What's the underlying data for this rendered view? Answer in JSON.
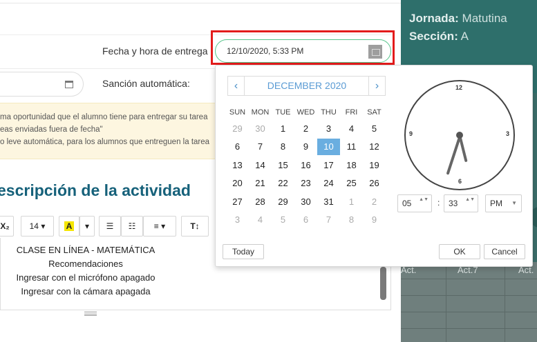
{
  "info": {
    "jornada_label": "Jornada:",
    "jornada_value": "Matutina",
    "seccion_label": "Sección:",
    "seccion_value": "A",
    "grid_headers": [
      "Act.",
      "Act.7",
      "Act."
    ]
  },
  "form": {
    "due_label": "Fecha y hora de entrega",
    "due_value": "12/10/2020, 5:33 PM",
    "sancion_label": "Sanción automática:",
    "notes": [
      "ma oportunidad que el alumno tiene para entregar su tarea",
      "eas enviadas fuera de fecha\"",
      "o leve automática, para los alumnos que entreguen la tarea"
    ],
    "heading": "escripción de la actividad"
  },
  "toolbar": {
    "font_size": "14",
    "font_size_caret": "▾",
    "subscript": "X₂",
    "text_color": "A",
    "caret": "▾",
    "bullet_list": "☰",
    "numbered_list": "☷",
    "align": "≡",
    "text_style": "T↕"
  },
  "editor": {
    "lines": [
      "CLASE EN LÍNEA - MATEMÁTICA",
      "Recomendaciones",
      "Ingresar con el micrófono apagado",
      "Ingresar con la cámara apagada"
    ]
  },
  "picker": {
    "prev": "‹",
    "next": "›",
    "month": "DECEMBER 2020",
    "weekdays": [
      "SUN",
      "MON",
      "TUE",
      "WED",
      "THU",
      "FRI",
      "SAT"
    ],
    "weeks": [
      [
        "29",
        "30",
        "1",
        "2",
        "3",
        "4",
        "5"
      ],
      [
        "6",
        "7",
        "8",
        "9",
        "10",
        "11",
        "12"
      ],
      [
        "13",
        "14",
        "15",
        "16",
        "17",
        "18",
        "19"
      ],
      [
        "20",
        "21",
        "22",
        "23",
        "24",
        "25",
        "26"
      ],
      [
        "27",
        "28",
        "29",
        "30",
        "31",
        "1",
        "2"
      ],
      [
        "3",
        "4",
        "5",
        "6",
        "7",
        "8",
        "9"
      ]
    ],
    "selected_day": "10",
    "clock_numbers": {
      "n12": "12",
      "n3": "3",
      "n6": "6",
      "n9": "9"
    },
    "hour": "05",
    "minute": "33",
    "colon": ":",
    "ampm": "PM",
    "spin_arrows": "▲▼",
    "today_label": "Today",
    "ok_label": "OK",
    "cancel_label": "Cancel"
  },
  "colors": {
    "accent": "#5a9bd4",
    "selected": "#6aaee0",
    "input_border": "#55c48a",
    "highlight": "#e31b1b",
    "panel": "#2f6b66",
    "heading": "#16617a"
  }
}
